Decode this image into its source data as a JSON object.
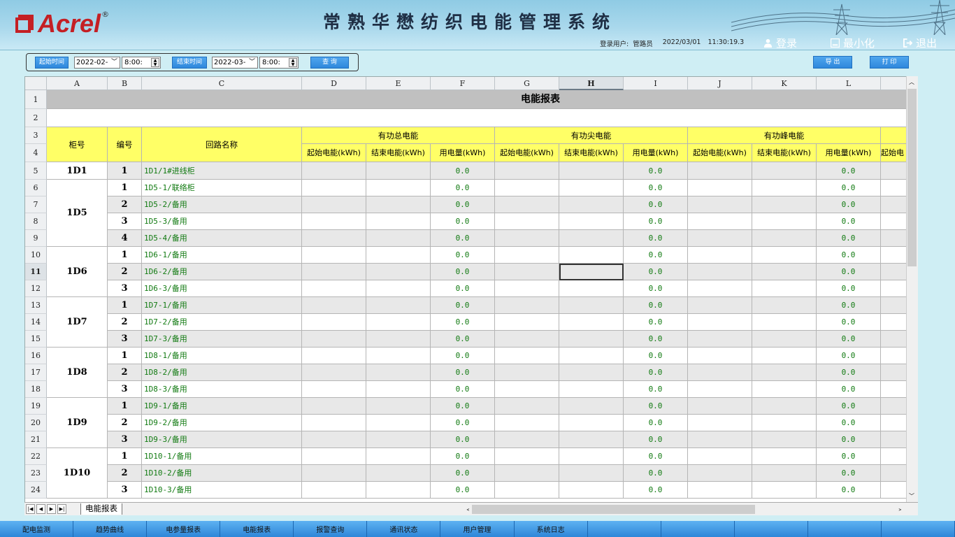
{
  "header": {
    "logo_text": "Acrel",
    "logo_reg": "®",
    "title": "常熟华懋纺织电能管理系统",
    "user_label": "登录用户:",
    "user_name": "管路员",
    "date": "2022/03/01",
    "time": "11:30:19.3",
    "login_label": "登录",
    "minimize_label": "最小化",
    "exit_label": "退出"
  },
  "toolbar": {
    "start_label": "起始时间",
    "start_date": "2022-02-",
    "start_time": "8:00:",
    "end_label": "结束时间",
    "end_date": "2022-03-",
    "end_time": "8:00:",
    "query_label": "查 询",
    "export_label": "导 出",
    "print_label": "打 印"
  },
  "sheet": {
    "columns": [
      "A",
      "B",
      "C",
      "D",
      "E",
      "F",
      "G",
      "H",
      "I",
      "J",
      "K",
      "L"
    ],
    "selected_column": "H",
    "selected_row": 11,
    "report_title": "电能报表",
    "hdr_cabinet": "柜号",
    "hdr_index": "编号",
    "hdr_loop": "回路名称",
    "groups": [
      "有功总电能",
      "有功尖电能",
      "有功峰电能"
    ],
    "subheaders": [
      "起始电能(kWh)",
      "结束电能(kWh)",
      "用电量(kWh)"
    ],
    "partial_sub": "起始电",
    "cabinets": [
      {
        "name": "1D1",
        "rows": [
          {
            "no": "1",
            "loop": "1D1/1#进线柜",
            "usage": "0.0"
          }
        ]
      },
      {
        "name": "1D5",
        "rows": [
          {
            "no": "1",
            "loop": "1D5-1/联络柜",
            "usage": "0.0"
          },
          {
            "no": "2",
            "loop": "1D5-2/备用",
            "usage": "0.0"
          },
          {
            "no": "3",
            "loop": "1D5-3/备用",
            "usage": "0.0"
          },
          {
            "no": "4",
            "loop": "1D5-4/备用",
            "usage": "0.0"
          }
        ]
      },
      {
        "name": "1D6",
        "rows": [
          {
            "no": "1",
            "loop": "1D6-1/备用",
            "usage": "0.0"
          },
          {
            "no": "2",
            "loop": "1D6-2/备用",
            "usage": "0.0"
          },
          {
            "no": "3",
            "loop": "1D6-3/备用",
            "usage": "0.0"
          }
        ]
      },
      {
        "name": "1D7",
        "rows": [
          {
            "no": "1",
            "loop": "1D7-1/备用",
            "usage": "0.0"
          },
          {
            "no": "2",
            "loop": "1D7-2/备用",
            "usage": "0.0"
          },
          {
            "no": "3",
            "loop": "1D7-3/备用",
            "usage": "0.0"
          }
        ]
      },
      {
        "name": "1D8",
        "rows": [
          {
            "no": "1",
            "loop": "1D8-1/备用",
            "usage": "0.0"
          },
          {
            "no": "2",
            "loop": "1D8-2/备用",
            "usage": "0.0"
          },
          {
            "no": "3",
            "loop": "1D8-3/备用",
            "usage": "0.0"
          }
        ]
      },
      {
        "name": "1D9",
        "rows": [
          {
            "no": "1",
            "loop": "1D9-1/备用",
            "usage": "0.0"
          },
          {
            "no": "2",
            "loop": "1D9-2/备用",
            "usage": "0.0"
          },
          {
            "no": "3",
            "loop": "1D9-3/备用",
            "usage": "0.0"
          }
        ]
      },
      {
        "name": "1D10",
        "rows": [
          {
            "no": "1",
            "loop": "1D10-1/备用",
            "usage": "0.0"
          },
          {
            "no": "2",
            "loop": "1D10-2/备用",
            "usage": "0.0"
          },
          {
            "no": "3",
            "loop": "1D10-3/备用",
            "usage": "0.0"
          }
        ]
      }
    ],
    "sheet_tab": "电能报表"
  },
  "bottom_nav": [
    "配电监测",
    "趋势曲线",
    "电参量报表",
    "电能报表",
    "报警查询",
    "通讯状态",
    "用户管理",
    "系统日志",
    "",
    "",
    "",
    "",
    ""
  ]
}
